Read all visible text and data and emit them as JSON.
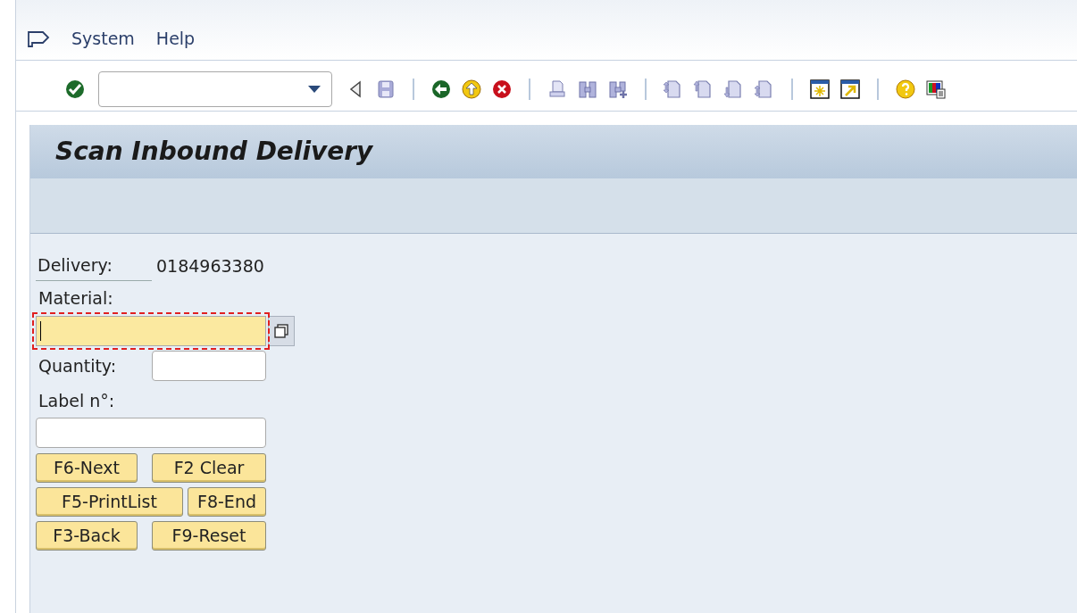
{
  "menu": [
    {
      "label": "System"
    },
    {
      "label": "Help"
    }
  ],
  "screen": {
    "title": "Scan Inbound Delivery"
  },
  "form": {
    "delivery": {
      "label": "Delivery:",
      "value": "0184963380"
    },
    "material": {
      "label": "Material:",
      "focused": true
    },
    "quantity": {
      "label": "Quantity:"
    },
    "label_no": {
      "label": "Label n°:"
    }
  },
  "button_rows": [
    [
      "F6-Next",
      "F2 Clear"
    ],
    [
      "F5-PrintList",
      "F8-End"
    ],
    [
      "F3-Back",
      "F9-Reset"
    ]
  ]
}
